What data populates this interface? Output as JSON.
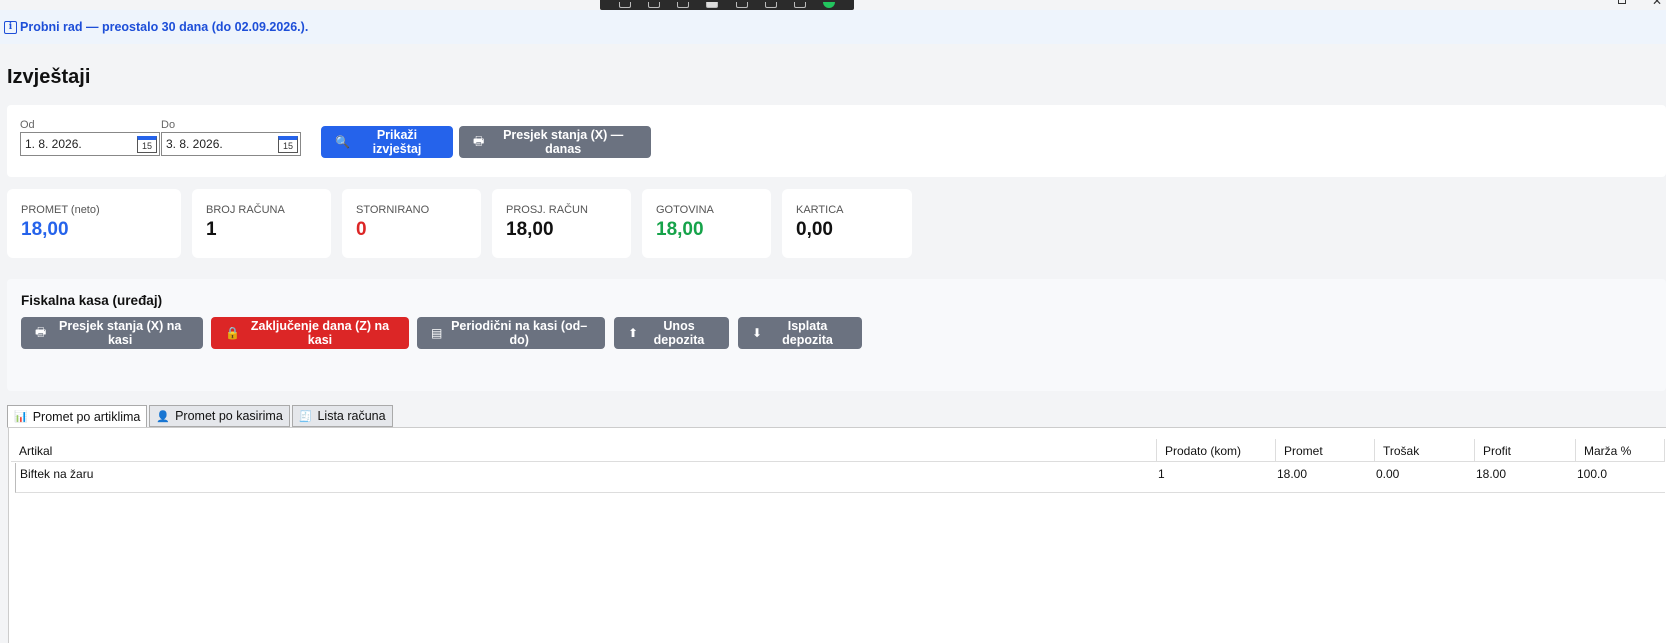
{
  "banner": {
    "text": "Probni rad — preostalo 30 dana (do 02.09.2026.)."
  },
  "page": {
    "title": "Izvještaji"
  },
  "filter": {
    "from_label": "Od",
    "from_value": "1. 8. 2026.",
    "to_label": "Do",
    "to_value": "3. 8. 2026.",
    "calendar_glyph": "15",
    "show_report_label": "Prikaži izvještaj",
    "x_report_today_label": "Presjek stanja (X) — danas"
  },
  "stats": [
    {
      "label": "PROMET (neto)",
      "value": "18,00",
      "color": "#2563eb"
    },
    {
      "label": "BROJ RAČUNA",
      "value": "1",
      "color": "#111111"
    },
    {
      "label": "STORNIRANO",
      "value": "0",
      "color": "#dc2626"
    },
    {
      "label": "PROSJ. RAČUN",
      "value": "18,00",
      "color": "#111111"
    },
    {
      "label": "GOTOVINA",
      "value": "18,00",
      "color": "#16a34a"
    },
    {
      "label": "KARTICA",
      "value": "0,00",
      "color": "#111111"
    }
  ],
  "fiscal": {
    "title": "Fiskalna kasa (uređaj)",
    "buttons": [
      {
        "label": "Presjek stanja (X) na kasi",
        "icon": "printer-icon"
      },
      {
        "label": "Zaključenje dana (Z) na kasi",
        "icon": "lock-icon"
      },
      {
        "label": "Periodični na kasi (od–do)",
        "icon": "report-icon"
      },
      {
        "label": "Unos depozita",
        "icon": "arrow-up-icon"
      },
      {
        "label": "Isplata depozita",
        "icon": "arrow-down-icon"
      }
    ]
  },
  "tabs": [
    {
      "label": "Promet po artiklima",
      "icon": "bar-chart-icon",
      "active": true
    },
    {
      "label": "Promet po kasirima",
      "icon": "person-icon",
      "active": false
    },
    {
      "label": "Lista računa",
      "icon": "receipt-icon",
      "active": false
    }
  ],
  "table": {
    "columns": [
      "Artikal",
      "Prodato (kom)",
      "Promet",
      "Trošak",
      "Profit",
      "Marža %"
    ],
    "rows": [
      [
        "Biftek na žaru",
        "1",
        "18.00",
        "0.00",
        "18.00",
        "100.0"
      ]
    ]
  },
  "colors": {
    "accent_blue": "#2563eb",
    "gray_button": "#6b7280",
    "red_button": "#dc2626",
    "banner_bg": "#eef4fc"
  }
}
